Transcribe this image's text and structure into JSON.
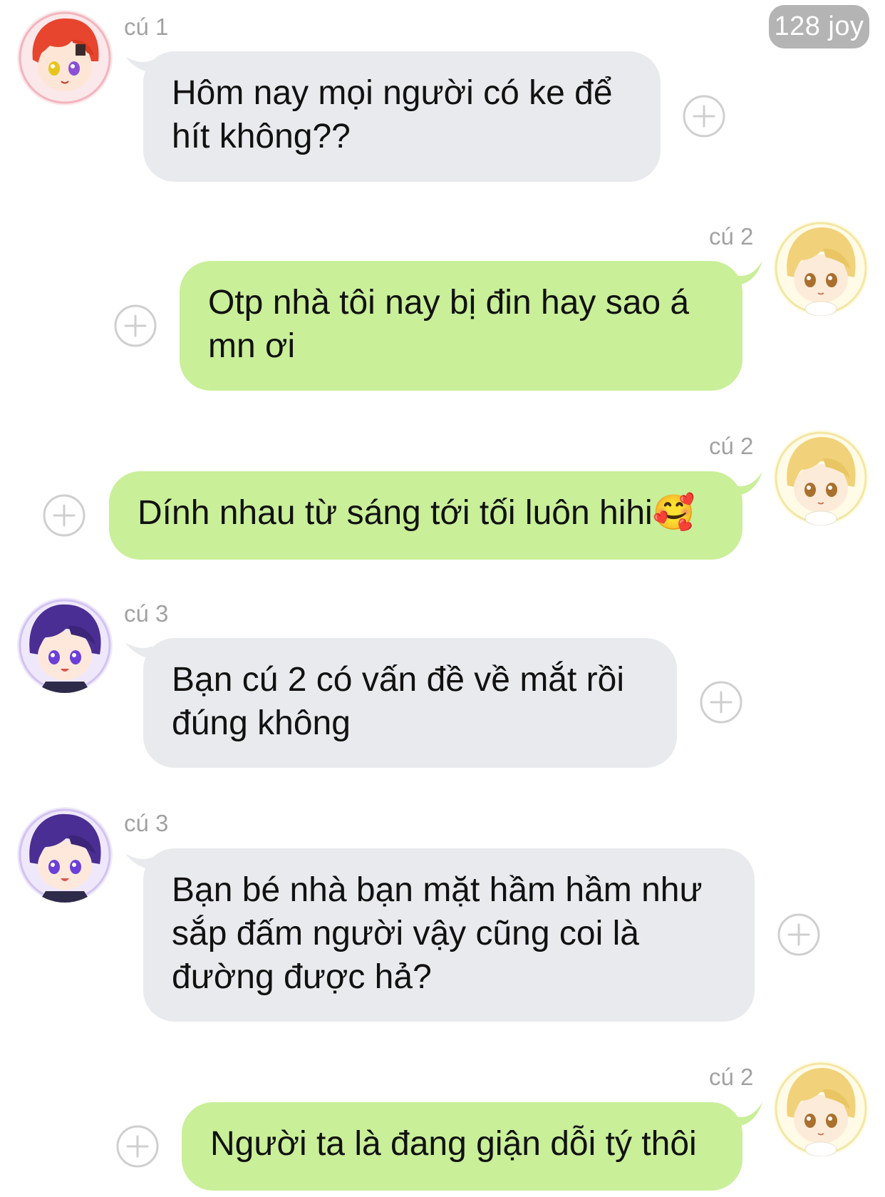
{
  "header": {
    "joy_badge": "128 joy"
  },
  "colors": {
    "incoming_bubble": "#e8eaed",
    "outgoing_bubble": "#c9ef99",
    "sender_name": "#a2a2a2",
    "badge": "#b4b4b4"
  },
  "messages": [
    {
      "sender": "cú 1",
      "side": "incoming",
      "avatar": "red-hair-avatar",
      "text": "Hôm nay mọi người có ke để\nhít không??",
      "reaction_icon": "add-reaction-icon"
    },
    {
      "sender": "cú 2",
      "side": "outgoing",
      "avatar": "blonde-avatar",
      "text": "Otp nhà tôi nay bị đin hay sao á\nmn ơi",
      "reaction_icon": "add-reaction-icon"
    },
    {
      "sender": "cú 2",
      "side": "outgoing",
      "avatar": "blonde-avatar",
      "text": "Dính nhau từ sáng tới tối luôn hihi🥰",
      "reaction_icon": "add-reaction-icon"
    },
    {
      "sender": "cú 3",
      "side": "incoming",
      "avatar": "purple-hair-avatar",
      "text": "Bạn cú 2 có vấn đề về mắt rồi\nđúng không",
      "reaction_icon": "add-reaction-icon"
    },
    {
      "sender": "cú 3",
      "side": "incoming",
      "avatar": "purple-hair-avatar",
      "text": "Bạn bé nhà bạn mặt hầm hầm như\nsắp đấm người vậy cũng coi là\nđường được hả?",
      "reaction_icon": "add-reaction-icon"
    },
    {
      "sender": "cú 2",
      "side": "outgoing",
      "avatar": "blonde-avatar",
      "text": "Người ta là đang giận dỗi tý thôi",
      "reaction_icon": "add-reaction-icon"
    }
  ]
}
